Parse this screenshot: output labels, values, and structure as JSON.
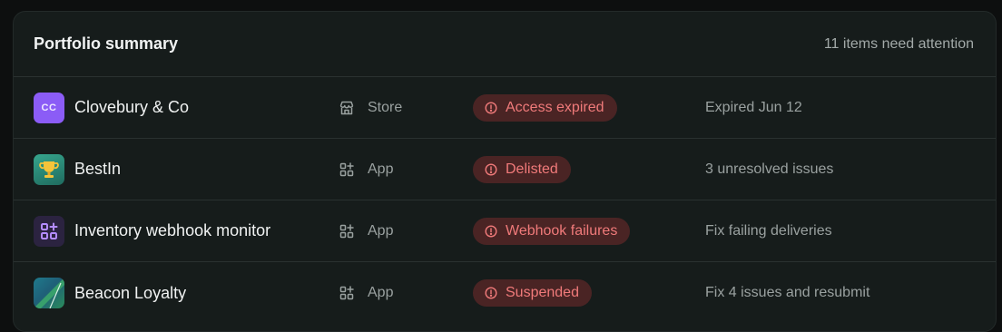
{
  "header": {
    "title": "Portfolio summary",
    "attention": "11 items need attention"
  },
  "rows": [
    {
      "initials": "CC",
      "name": "Clovebury & Co",
      "type": "Store",
      "type_icon": "store-icon",
      "status": "Access expired",
      "detail": "Expired Jun 12",
      "avatar_icon": "initials-avatar"
    },
    {
      "name": "BestIn",
      "type": "App",
      "type_icon": "apps-icon",
      "status": "Delisted",
      "detail": "3 unresolved issues",
      "avatar_icon": "trophy-icon"
    },
    {
      "name": "Inventory webhook monitor",
      "type": "App",
      "type_icon": "apps-icon",
      "status": "Webhook failures",
      "detail": "Fix failing deliveries",
      "avatar_icon": "grid-plus-icon"
    },
    {
      "name": "Beacon Loyalty",
      "type": "App",
      "type_icon": "apps-icon",
      "status": "Suspended",
      "detail": "Fix 4 issues and resubmit",
      "avatar_icon": "beacon-logo"
    }
  ],
  "colors": {
    "badge_bg": "#4a2424",
    "badge_text": "#f07a7a",
    "card_bg": "#161c1b"
  }
}
